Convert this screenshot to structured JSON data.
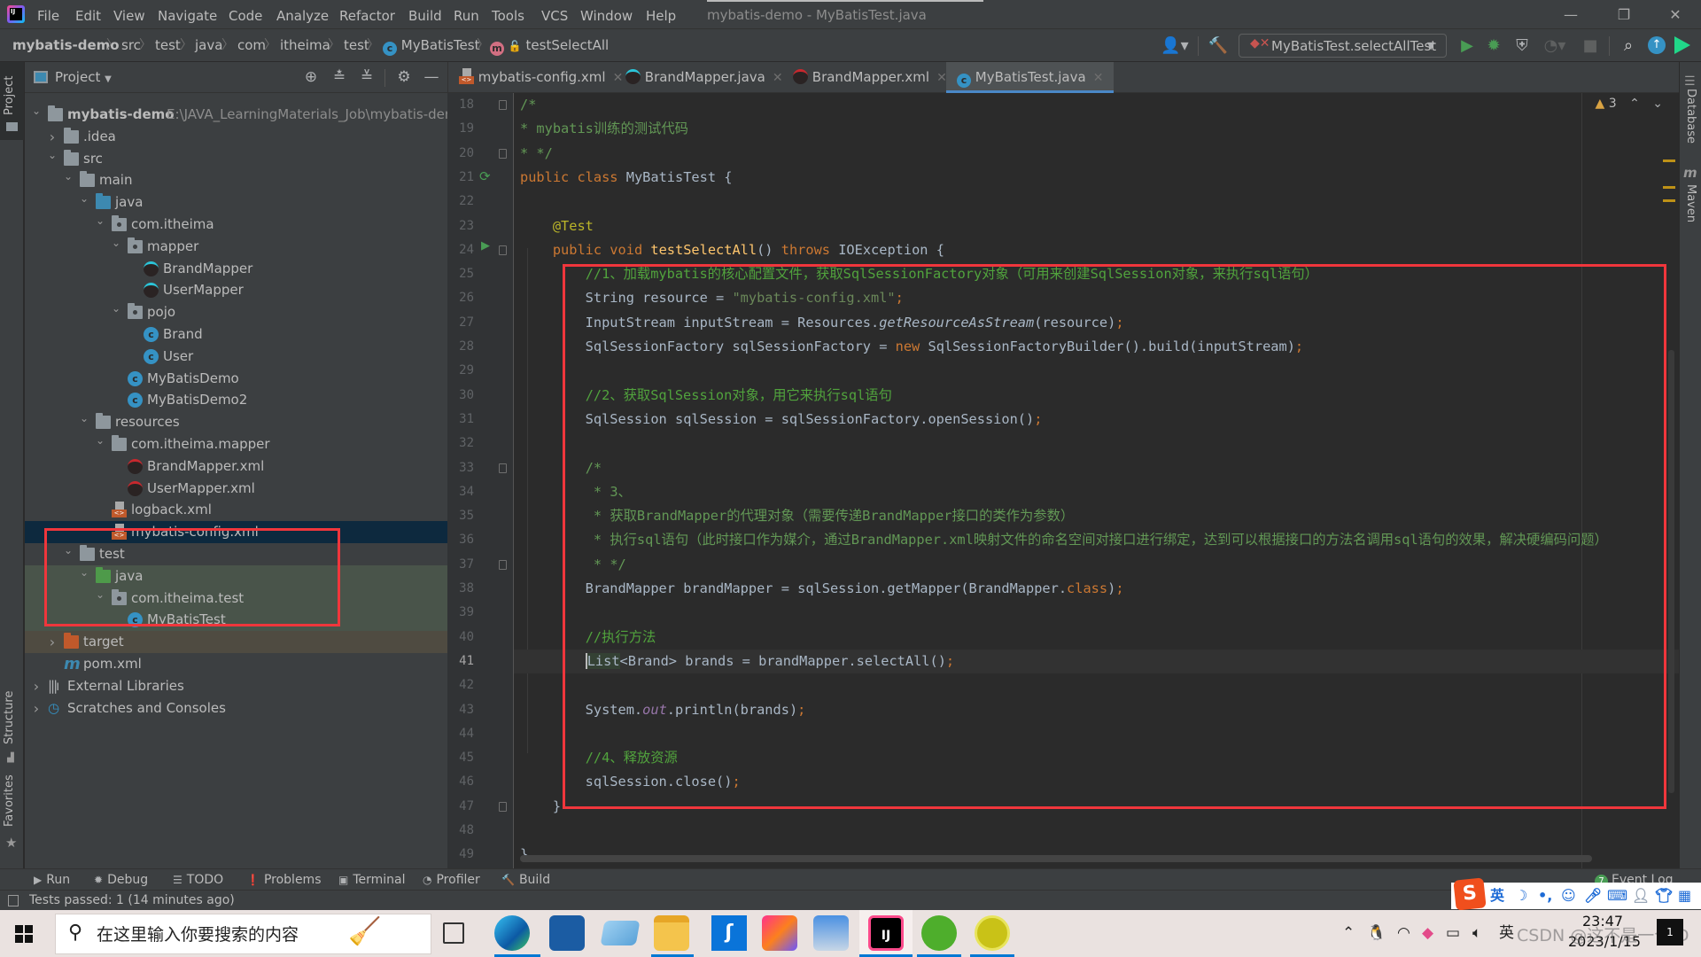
{
  "window": {
    "title": "mybatis-demo - MyBatisTest.java",
    "controls": {
      "minimize": "—",
      "restore": "❐",
      "close": "✕"
    }
  },
  "menu": [
    "File",
    "Edit",
    "View",
    "Navigate",
    "Code",
    "Analyze",
    "Refactor",
    "Build",
    "Run",
    "Tools",
    "VCS",
    "Window",
    "Help"
  ],
  "breadcrumb": [
    "mybatis-demo",
    "src",
    "test",
    "java",
    "com",
    "itheima",
    "test",
    "MyBatisTest",
    "testSelectAll"
  ],
  "toolbar": {
    "run_config": "MyBatisTest.selectAllTest",
    "icons": [
      "user-icon",
      "build-hammer-icon",
      "run-icon",
      "debug-icon",
      "coverage-icon",
      "profile-icon",
      "stop-icon",
      "search-icon",
      "update-icon",
      "toolbox-icon"
    ]
  },
  "left_stripe": {
    "project": "Project",
    "structure": "Structure",
    "favorites": "Favorites"
  },
  "right_stripe": {
    "database": "Database",
    "maven": "Maven"
  },
  "project_panel": {
    "title": "Project",
    "tree": [
      {
        "label": "mybatis-demo",
        "path": "E:\\JAVA_LearningMaterials_Job\\mybatis-demo",
        "depth": 0,
        "expanded": true,
        "icon": "module"
      },
      {
        "label": ".idea",
        "depth": 1,
        "expanded": false,
        "icon": "folder"
      },
      {
        "label": "src",
        "depth": 1,
        "expanded": true,
        "icon": "folder"
      },
      {
        "label": "main",
        "depth": 2,
        "expanded": true,
        "icon": "folder"
      },
      {
        "label": "java",
        "depth": 3,
        "expanded": true,
        "icon": "folder-blue"
      },
      {
        "label": "com.itheima",
        "depth": 4,
        "expanded": true,
        "icon": "package"
      },
      {
        "label": "mapper",
        "depth": 5,
        "expanded": true,
        "icon": "package"
      },
      {
        "label": "BrandMapper",
        "depth": 6,
        "icon": "mapper"
      },
      {
        "label": "UserMapper",
        "depth": 6,
        "icon": "mapper"
      },
      {
        "label": "pojo",
        "depth": 5,
        "expanded": true,
        "icon": "package"
      },
      {
        "label": "Brand",
        "depth": 6,
        "icon": "class"
      },
      {
        "label": "User",
        "depth": 6,
        "icon": "class"
      },
      {
        "label": "MyBatisDemo",
        "depth": 5,
        "icon": "class-run"
      },
      {
        "label": "MyBatisDemo2",
        "depth": 5,
        "icon": "class-run"
      },
      {
        "label": "resources",
        "depth": 3,
        "expanded": true,
        "icon": "folder-res"
      },
      {
        "label": "com.itheima.mapper",
        "depth": 4,
        "expanded": true,
        "icon": "folder"
      },
      {
        "label": "BrandMapper.xml",
        "depth": 5,
        "icon": "mapper-xml"
      },
      {
        "label": "UserMapper.xml",
        "depth": 5,
        "icon": "mapper-xml"
      },
      {
        "label": "logback.xml",
        "depth": 4,
        "icon": "xml"
      },
      {
        "label": "mybatis-config.xml",
        "depth": 4,
        "icon": "xml",
        "selected": true
      },
      {
        "label": "test",
        "depth": 2,
        "expanded": true,
        "icon": "folder"
      },
      {
        "label": "java",
        "depth": 3,
        "expanded": true,
        "icon": "folder-green"
      },
      {
        "label": "com.itheima.test",
        "depth": 4,
        "expanded": true,
        "icon": "package"
      },
      {
        "label": "MyBatisTest",
        "depth": 5,
        "icon": "class-test"
      },
      {
        "label": "target",
        "depth": 1,
        "expanded": false,
        "icon": "folder-orange"
      },
      {
        "label": "pom.xml",
        "depth": 1,
        "icon": "maven"
      },
      {
        "label": "External Libraries",
        "depth": 0,
        "expanded": false,
        "icon": "libraries"
      },
      {
        "label": "Scratches and Consoles",
        "depth": 0,
        "expanded": false,
        "icon": "scratches"
      }
    ]
  },
  "editor": {
    "tabs": [
      {
        "label": "mybatis-config.xml",
        "icon": "xml"
      },
      {
        "label": "BrandMapper.java",
        "icon": "mapper"
      },
      {
        "label": "BrandMapper.xml",
        "icon": "mapper-xml"
      },
      {
        "label": "MyBatisTest.java",
        "icon": "class-test",
        "active": true
      }
    ],
    "inspection": {
      "warnings": "3"
    },
    "current_line": 41,
    "lines": [
      {
        "n": 18,
        "html": "<span class='cm'>/*</span>"
      },
      {
        "n": 19,
        "html": "<span class='cm'>* mybatis训练的测试代码</span>"
      },
      {
        "n": 20,
        "html": "<span class='cm'>* */</span>"
      },
      {
        "n": 21,
        "html": "<span class='kw'>public class </span>MyBatisTest {"
      },
      {
        "n": 22,
        "html": ""
      },
      {
        "n": 23,
        "html": "    <span class='ann'>@Test</span>"
      },
      {
        "n": 24,
        "html": "    <span class='kw'>public void </span><span class='fn'>testSelectAll</span>() <span class='kw'>throws </span>IOException {"
      },
      {
        "n": 25,
        "html": "        <span class='lc'>//1、加载mybatis的核心配置文件，获取SqlSessionFactory对象（可用来创建SqlSession对象，来执行sql语句）</span>"
      },
      {
        "n": 26,
        "html": "        String resource = <span class='str'>\"mybatis-config.xml\"</span><span class='kw'>;</span>"
      },
      {
        "n": 27,
        "html": "        InputStream inputStream = Resources.<span class='ital'>getResourceAsStream</span>(resource)<span class='kw'>;</span>"
      },
      {
        "n": 28,
        "html": "        SqlSessionFactory sqlSessionFactory = <span class='kw'>new </span>SqlSessionFactoryBuilder().build(inputStream)<span class='kw'>;</span>"
      },
      {
        "n": 29,
        "html": ""
      },
      {
        "n": 30,
        "html": "        <span class='lc'>//2、获取SqlSession对象，用它来执行sql语句</span>"
      },
      {
        "n": 31,
        "html": "        SqlSession sqlSession = sqlSessionFactory.openSession()<span class='kw'>;</span>"
      },
      {
        "n": 32,
        "html": ""
      },
      {
        "n": 33,
        "html": "        <span class='cm'>/*</span>"
      },
      {
        "n": 34,
        "html": "        <span class='cm'> * 3、</span>"
      },
      {
        "n": 35,
        "html": "        <span class='cm'> * 获取BrandMapper的代理对象（需要传递BrandMapper接口的类作为参数）</span>"
      },
      {
        "n": 36,
        "html": "        <span class='cm'> * 执行sql语句（此时接口作为媒介，通过BrandMapper.xml映射文件的命名空间对接口进行绑定，达到可以根据接口的方法名调用sql语句的效果，解决硬编码问题）</span>"
      },
      {
        "n": 37,
        "html": "        <span class='cm'> * */</span>"
      },
      {
        "n": 38,
        "html": "        BrandMapper brandMapper = sqlSession.getMapper(BrandMapper.<span class='kw'>class</span>)<span class='kw'>;</span>"
      },
      {
        "n": 39,
        "html": ""
      },
      {
        "n": 40,
        "html": "        <span class='lc'>//执行方法</span>"
      },
      {
        "n": 41,
        "html": "        <span class='caret-bg'>List</span>&lt;Brand&gt; brands = brandMapper.selectAll()<span class='kw'>;</span>"
      },
      {
        "n": 42,
        "html": ""
      },
      {
        "n": 43,
        "html": "        System.<span class='stat'>out</span>.println(brands)<span class='kw'>;</span>"
      },
      {
        "n": 44,
        "html": ""
      },
      {
        "n": 45,
        "html": "        <span class='lc'>//4、释放资源</span>"
      },
      {
        "n": 46,
        "html": "        sqlSession.close()<span class='kw'>;</span>"
      },
      {
        "n": 47,
        "html": "    }"
      },
      {
        "n": 48,
        "html": ""
      },
      {
        "n": 49,
        "html": "}"
      }
    ]
  },
  "bottom_tools": [
    {
      "label": "Run",
      "icon": "run-icon"
    },
    {
      "label": "Debug",
      "icon": "debug-icon"
    },
    {
      "label": "TODO",
      "icon": "todo-icon"
    },
    {
      "label": "Problems",
      "icon": "problems-icon"
    },
    {
      "label": "Terminal",
      "icon": "terminal-icon"
    },
    {
      "label": "Profiler",
      "icon": "profiler-icon"
    },
    {
      "label": "Build",
      "icon": "build-icon"
    }
  ],
  "event_log": {
    "label": "Event Log",
    "count": "7"
  },
  "status": {
    "text": "Tests passed: 1 (14 minutes ago)"
  },
  "ime": {
    "mode": "英"
  },
  "taskbar": {
    "search_placeholder": "在这里输入你要搜索的内容",
    "tray_lang": "英",
    "time": "23:47",
    "date": "2023/1/15",
    "watermark": "CSDN @这不是一个ID"
  }
}
